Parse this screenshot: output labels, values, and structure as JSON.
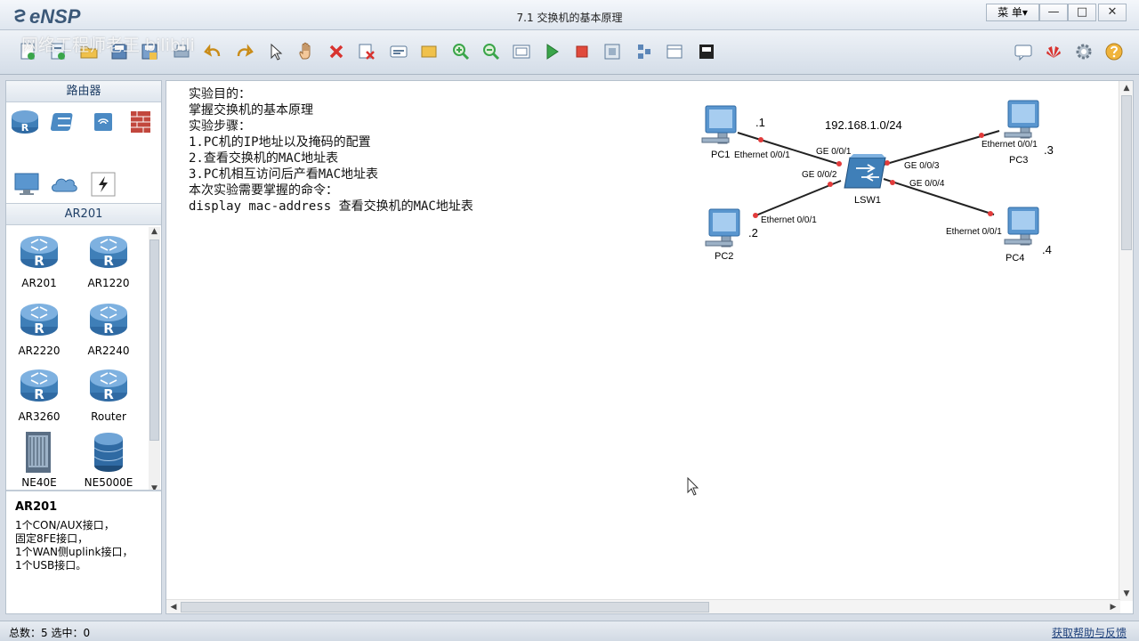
{
  "app": {
    "name": "eNSP",
    "window_title": "7.1 交换机的基本原理",
    "menu_label": "菜 单▾",
    "watermark": "网络工程师老王 bilibili"
  },
  "window_controls": {
    "minimize": "—",
    "maximize": "□",
    "close": "✕"
  },
  "left_panel": {
    "category_header": "路由器",
    "model_header": "AR201",
    "models": [
      {
        "label": "AR201"
      },
      {
        "label": "AR1220"
      },
      {
        "label": "AR2220"
      },
      {
        "label": "AR2240"
      },
      {
        "label": "AR3260"
      },
      {
        "label": "Router"
      },
      {
        "label": "NE40E"
      },
      {
        "label": "NE5000E"
      }
    ],
    "description": {
      "title": "AR201",
      "lines": [
        "1个CON/AUX接口，",
        "固定8FE接口，",
        "1个WAN侧uplink接口，",
        "1个USB接口。"
      ]
    }
  },
  "notes": {
    "lines": [
      "实验目的：",
      "掌握交换机的基本原理",
      "",
      "实验步骤：",
      "1.PC机的IP地址以及掩码的配置",
      "2.查看交换机的MAC地址表",
      "3.PC机相互访问后产看MAC地址表",
      "",
      "本次实验需要掌握的命令：",
      "display mac-address 查看交换机的MAC地址表"
    ]
  },
  "topology": {
    "subnet": "192.168.1.0/24",
    "switch": {
      "label": "LSW1"
    },
    "pcs": [
      {
        "label": "PC1",
        "host": ".1",
        "iface": "Ethernet 0/0/1",
        "sw_port": "GE 0/0/1"
      },
      {
        "label": "PC2",
        "host": ".2",
        "iface": "Ethernet 0/0/1",
        "sw_port": "GE 0/0/2"
      },
      {
        "label": "PC3",
        "host": ".3",
        "iface": "Ethernet 0/0/1",
        "sw_port": "GE 0/0/3"
      },
      {
        "label": "PC4",
        "host": ".4",
        "iface": "Ethernet 0/0/1",
        "sw_port": "GE 0/0/4"
      }
    ]
  },
  "status": {
    "text": "总数：5 选中：0",
    "help": "获取帮助与反馈"
  },
  "colors": {
    "link_dot": "#e23b3b",
    "accent": "#2a6fb5",
    "router_blue": "#3f7fb8"
  },
  "toolbar_icons": [
    "new-topology-icon",
    "new-example-icon",
    "open-icon",
    "save-icon",
    "save-as-icon",
    "print-icon",
    "undo-icon",
    "redo-icon",
    "select-icon",
    "pan-icon",
    "delete-icon",
    "delete-link-icon",
    "text-icon",
    "palette-icon",
    "zoom-in-icon",
    "zoom-out-icon",
    "fit-icon",
    "start-icon",
    "stop-icon",
    "capture-icon",
    "show-ports-icon",
    "grid-icon",
    "topo-icon",
    "forum-icon",
    "huawei-icon",
    "settings-icon",
    "help-icon"
  ]
}
